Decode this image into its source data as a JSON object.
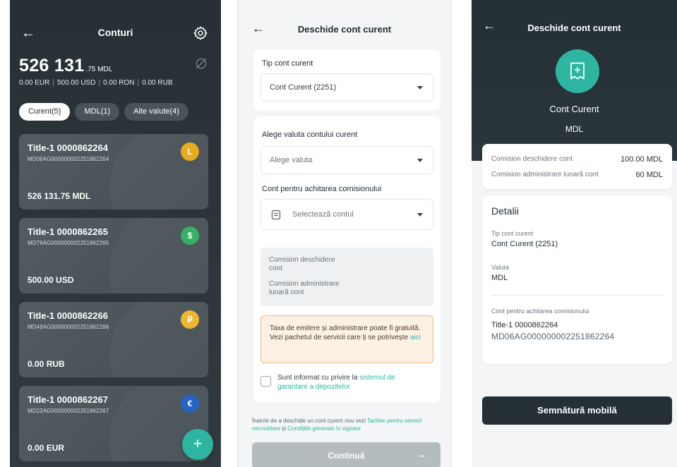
{
  "screen1": {
    "title": "Conturi",
    "balance_main": "526 131",
    "balance_decimals": ".75 MDL",
    "other_balances": [
      "0.00 EUR",
      "500.00 USD",
      "0.00 RON",
      "0.00 RUB"
    ],
    "tabs": [
      "Curent(5)",
      "MDL(1)",
      "Alte valute(4)"
    ],
    "accounts": [
      {
        "title": "Title-1 0000862264",
        "iban": "MD06AG000000002251862264",
        "amount": "526 131.75 MDL",
        "currency_icon": "L",
        "color": "#e6a817"
      },
      {
        "title": "Title-1 0000862265",
        "iban": "MD76AG000000002251862265",
        "amount": "500.00 USD",
        "currency_icon": "$",
        "color": "#2fae5f"
      },
      {
        "title": "Title-1 0000862266",
        "iban": "MD49AG000000002251862266",
        "amount": "0.00 RUB",
        "currency_icon": "₽",
        "color": "#f0b429"
      },
      {
        "title": "Title-1 0000862267",
        "iban": "MD22AG000000002251862267",
        "amount": "0.00 EUR",
        "currency_icon": "€",
        "color": "#1f5fbf"
      }
    ],
    "fab_label": "+"
  },
  "screen2": {
    "title": "Deschide cont curent",
    "type_label": "Tip cont curent",
    "type_value": "Cont Curent (2251)",
    "currency_label": "Alege valuta contului curent",
    "currency_placeholder": "Alege valuta",
    "fee_account_label": "Cont pentru achitarea comisionului",
    "fee_account_placeholder": "Selectează contul",
    "fee_open_l1": "Comision deschidere",
    "fee_open_l2": "cont",
    "fee_admin_l1": "Comision administrare",
    "fee_admin_l2": "lunară cont",
    "notice_text": "Taxa de emitere și administrare poate fi gratuită. Vezi pachetul de servicii care ți se potrivește ",
    "notice_link": "aici",
    "checkbox_text": "Sunt informat cu privire la ",
    "checkbox_link_1": "sistemul de",
    "checkbox_link_2": "garantare a depozitelor",
    "footnote_1": "Înainte de a deschide un cont curent nou vezi ",
    "footnote_link_1": "Tarifele pentru servicii necreditare",
    "footnote_2": " și ",
    "footnote_link_2": "Condițiile generale în vigoare",
    "continue_label": "Continuă",
    "continue_arrow": "→"
  },
  "screen3": {
    "title": "Deschide cont curent",
    "account_name": "Cont Curent",
    "currency": "MDL",
    "fee_open_label": "Comision deschidere cont",
    "fee_open_value": "100.00 MDL",
    "fee_admin_label": "Comision administrare lunară cont",
    "fee_admin_value": "60 MDL",
    "details_heading": "Detalii",
    "type_label": "Tip cont curent",
    "type_value": "Cont Curent (2251)",
    "currency_label": "Valuta",
    "currency_value": "MDL",
    "fee_account_label": "Cont pentru achitarea comisionului",
    "fee_account_title": "Title-1 0000862264",
    "fee_account_iban": "MD06AG000000002251862264",
    "sign_button": "Semnătură mobilă"
  },
  "colors": {
    "accent": "#2eb5a1",
    "dark": "#243036"
  }
}
